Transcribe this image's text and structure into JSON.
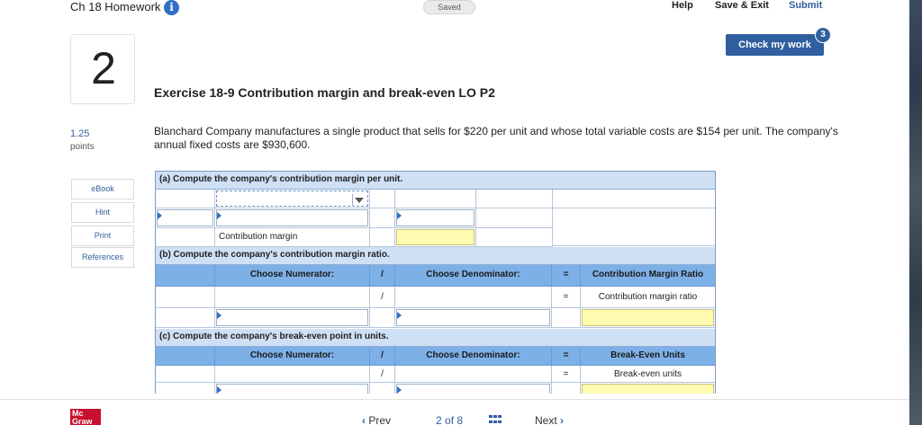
{
  "topbar": {
    "title": "Ch 18 Homework",
    "info_glyph": "i",
    "status": "Saved",
    "help": "Help",
    "save_exit": "Save & Exit",
    "submit": "Submit"
  },
  "check_work": {
    "label": "Check my work",
    "badge": "3"
  },
  "question": {
    "number": "2",
    "title": "Exercise 18-9 Contribution margin and break-even LO P2",
    "points_value": "1.25",
    "points_label": "points",
    "text": "Blanchard Company manufactures a single product that sells for $220 per unit and whose total variable costs are $154 per unit. The company's annual fixed costs are $930,600."
  },
  "side_tools": [
    "eBook",
    "Hint",
    "Print",
    "References"
  ],
  "worksheet": {
    "section_a": "(a) Compute the company's contribution margin per unit.",
    "row_a_label": "Contribution margin",
    "section_b": "(b) Compute the company's contribution margin ratio.",
    "section_c": "(c) Compute the company's break-even point in units.",
    "choose_numerator": "Choose Numerator:",
    "choose_denominator": "Choose Denominator:",
    "divide": "/",
    "equals": "=",
    "b_result_header": "Contribution Margin Ratio",
    "b_result_label": "Contribution margin ratio",
    "c_result_header": "Break-Even Units",
    "c_result_label": "Break-even units"
  },
  "bottom": {
    "logo": "Mc Graw",
    "prev": "Prev",
    "page_current": "2",
    "page_of": "of",
    "page_total": "8",
    "next": "Next"
  },
  "colors": {
    "accent": "#2f5f9e",
    "header_blue": "#7eb0e8",
    "answer_yellow": "#fffbb0"
  },
  "icons": {
    "info": "info-icon",
    "dropdown": "chevron-down-icon",
    "grid": "grid-icon",
    "prev": "chevron-left-icon",
    "next": "chevron-right-icon"
  }
}
